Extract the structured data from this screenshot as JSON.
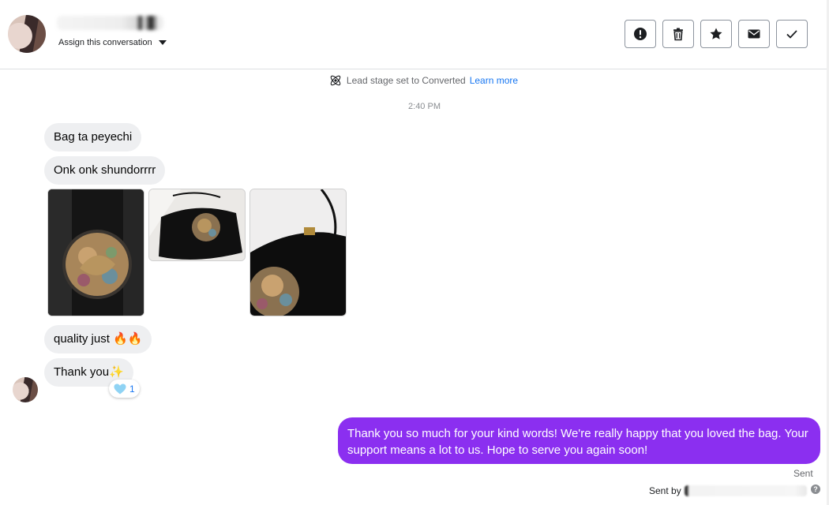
{
  "header": {
    "contact_name": "",
    "assign_label": "Assign this conversation",
    "actions": [
      {
        "name": "report-spam",
        "icon": "exclamation-circle-icon"
      },
      {
        "name": "delete",
        "icon": "trash-icon"
      },
      {
        "name": "star",
        "icon": "star-icon"
      },
      {
        "name": "mark-unread",
        "icon": "envelope-icon"
      },
      {
        "name": "mark-done",
        "icon": "checkmark-icon"
      }
    ]
  },
  "system_event": {
    "icon": "atom-icon",
    "text": "Lead stage set to Converted",
    "link": "Learn more"
  },
  "timestamp": "2:40 PM",
  "messages_in": [
    {
      "text": "Bag ta peyechi"
    },
    {
      "text": "Onk onk shundorrrr"
    },
    {
      "text": "quality just 🔥🔥"
    },
    {
      "text": "Thank you✨"
    }
  ],
  "attachments": [
    {
      "icon": "photo-thumbnail",
      "desc": "black leather bag with embossed bird medallion"
    },
    {
      "icon": "photo-thumbnail",
      "desc": "black leather shoulder bag"
    },
    {
      "icon": "photo-thumbnail",
      "desc": "black leather bag side view"
    }
  ],
  "reaction": {
    "icon": "light-blue-heart-icon",
    "count": "1"
  },
  "message_out": {
    "text": "Thank you so much for your kind words! We're really happy that you loved the bag. Your support means a lot to us. Hope to serve you again soon!",
    "status": "Sent",
    "sent_by_prefix": "Sent by",
    "sent_by_name": ""
  },
  "colors": {
    "outgoing_bubble": "#8b2ff0",
    "incoming_bubble": "#eeeff1",
    "link": "#1877f2"
  }
}
